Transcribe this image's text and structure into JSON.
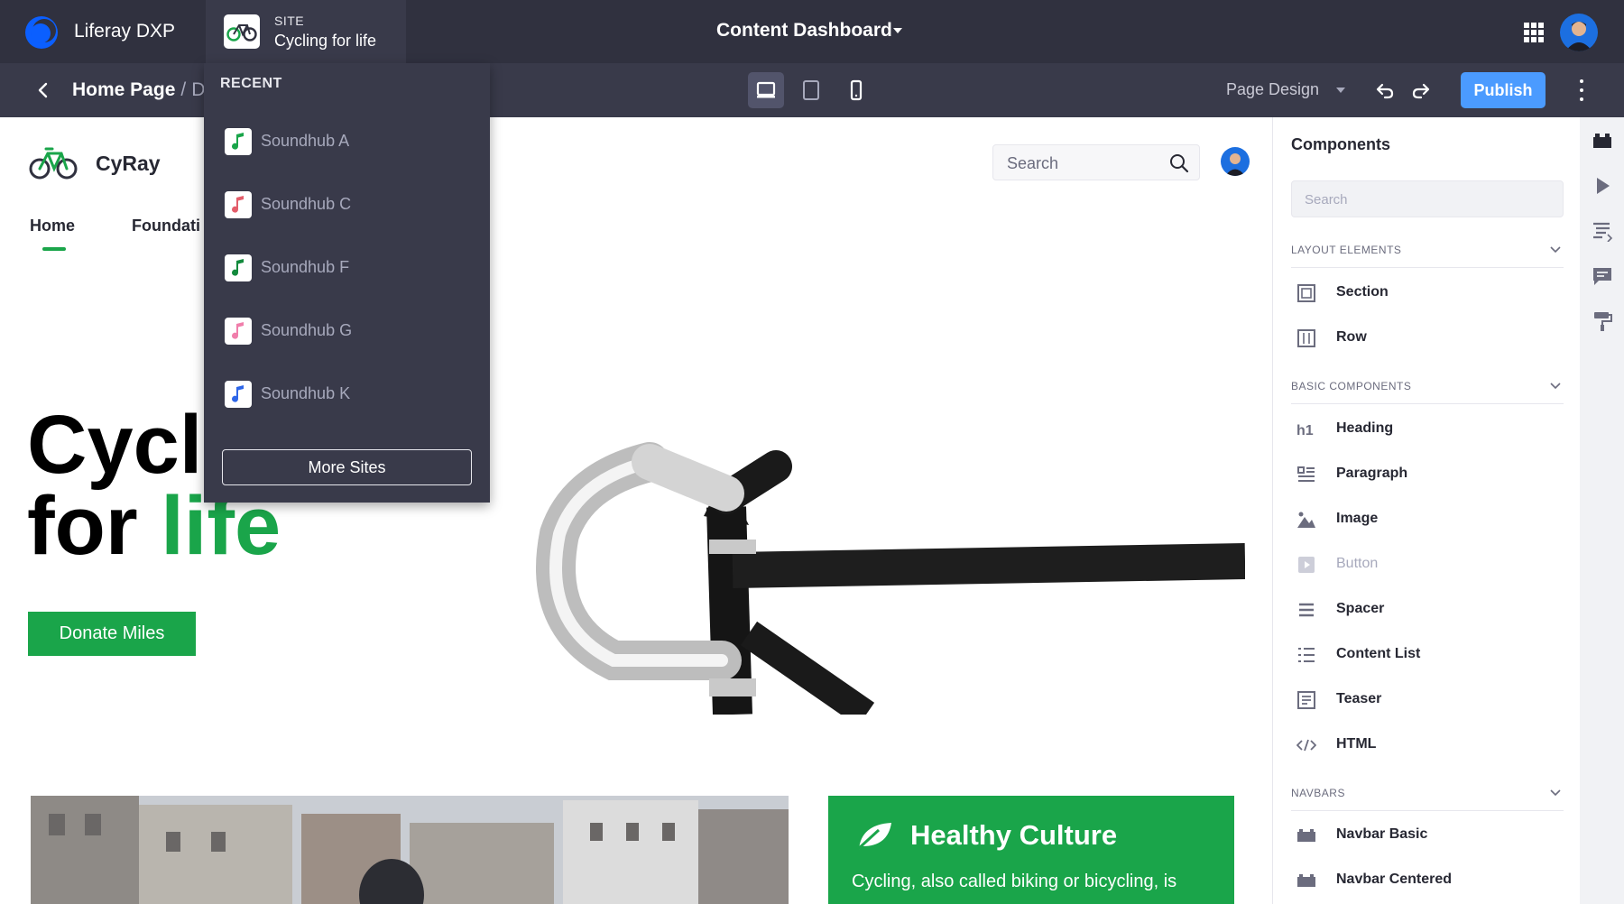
{
  "topbar": {
    "brand": "Liferay DXP",
    "site_label": "SITE",
    "site_name": "Cycling for life",
    "dashboard_title": "Content Dashboard"
  },
  "subbar": {
    "breadcrumb_page": "Home Page",
    "breadcrumb_sep": "/",
    "breadcrumb_rest": "D",
    "page_design": "Page Design",
    "publish": "Publish"
  },
  "dropdown": {
    "header": "RECENT",
    "items": [
      {
        "label": "Soundhub A",
        "color": "#1aa54a"
      },
      {
        "label": "Soundhub C",
        "color": "#e35d6a"
      },
      {
        "label": "Soundhub F",
        "color": "#138a3d"
      },
      {
        "label": "Soundhub G",
        "color": "#f07eab"
      },
      {
        "label": "Soundhub K",
        "color": "#2e66e8"
      }
    ],
    "more_sites": "More Sites"
  },
  "site": {
    "name": "CyRay",
    "nav_home": "Home",
    "nav_foundation": "Foundati",
    "search_placeholder": "Search",
    "hero_line1": "Cycl",
    "hero_line2_a": "for ",
    "hero_line2_b": "life",
    "donate": "Donate Miles",
    "card_title": "Healthy Culture",
    "card_text": "Cycling, also called biking or bicycling, is"
  },
  "sidebar": {
    "title": "Components",
    "search_placeholder": "Search",
    "sections": [
      {
        "label": "LAYOUT ELEMENTS"
      },
      {
        "label": "BASIC COMPONENTS"
      },
      {
        "label": "NAVBARS"
      }
    ],
    "layout_items": [
      "Section",
      "Row"
    ],
    "basic_items": [
      "Heading",
      "Paragraph",
      "Image",
      "Button",
      "Spacer",
      "Content List",
      "Teaser",
      "HTML"
    ],
    "navbar_items": [
      "Navbar Basic",
      "Navbar Centered"
    ]
  },
  "colors": {
    "accent_green": "#1aa54a",
    "publish_blue": "#4b9bff",
    "dark_bar": "#30313f"
  }
}
